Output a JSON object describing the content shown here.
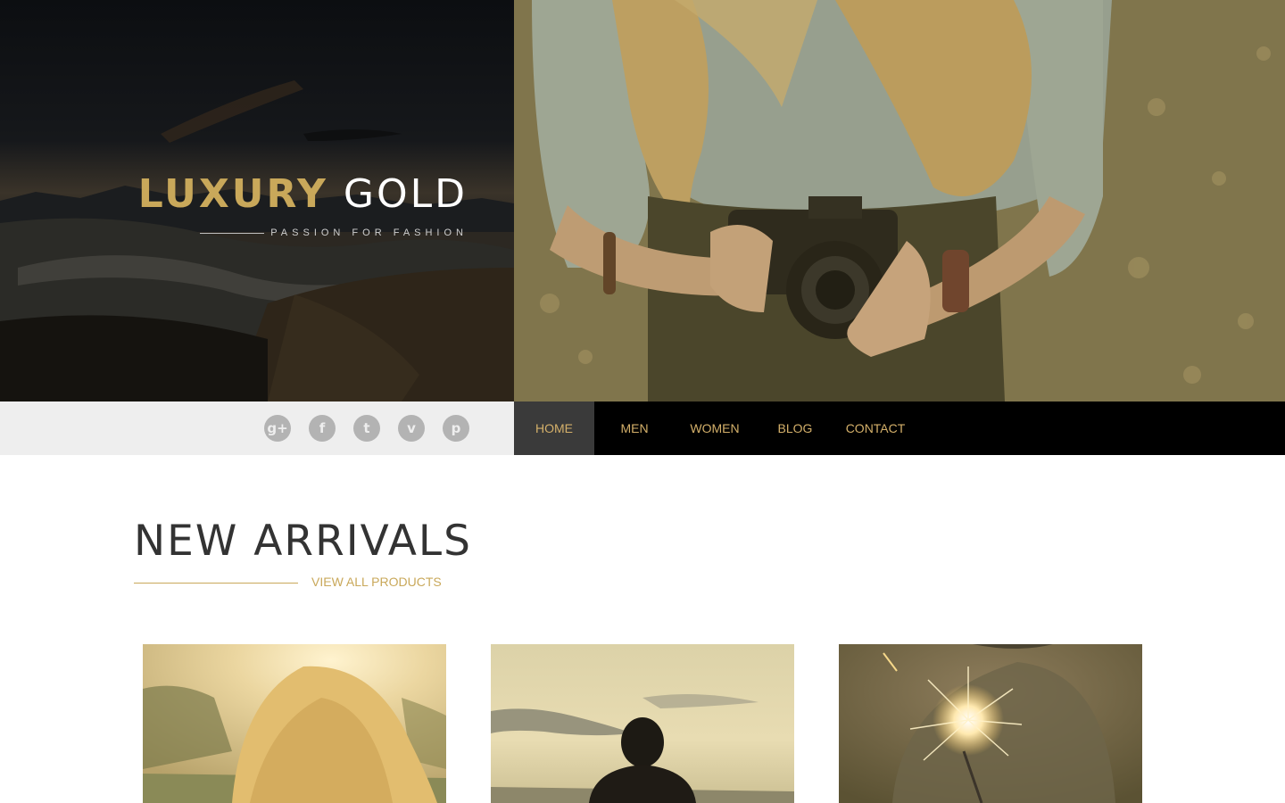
{
  "brand": {
    "word_gold": "LUXURY",
    "word_white": "GOLD",
    "tagline": "PASSION FOR FASHION"
  },
  "social": [
    {
      "name": "google-plus-icon",
      "glyph": "g+"
    },
    {
      "name": "facebook-icon",
      "glyph": "f"
    },
    {
      "name": "twitter-icon",
      "glyph": "t"
    },
    {
      "name": "vimeo-icon",
      "glyph": "v"
    },
    {
      "name": "pinterest-icon",
      "glyph": "p"
    }
  ],
  "nav": {
    "items": [
      "HOME",
      "MEN",
      "WOMEN",
      "BLOG",
      "CONTACT"
    ],
    "active": "HOME"
  },
  "section": {
    "title": "NEW ARRIVALS",
    "view_all": "VIEW ALL PRODUCTS"
  },
  "products": [
    {
      "name": "product-image-sunlit-hair"
    },
    {
      "name": "product-image-man-silhouette"
    },
    {
      "name": "product-image-sparkler"
    }
  ],
  "colors": {
    "accent_gold": "#c9a85a",
    "nav_bg": "#000000",
    "nav_active_bg": "#3a3a3a",
    "social_bar_bg": "#eeeeee",
    "social_icon_bg": "#b3b3b3",
    "heading_text": "#333333"
  }
}
